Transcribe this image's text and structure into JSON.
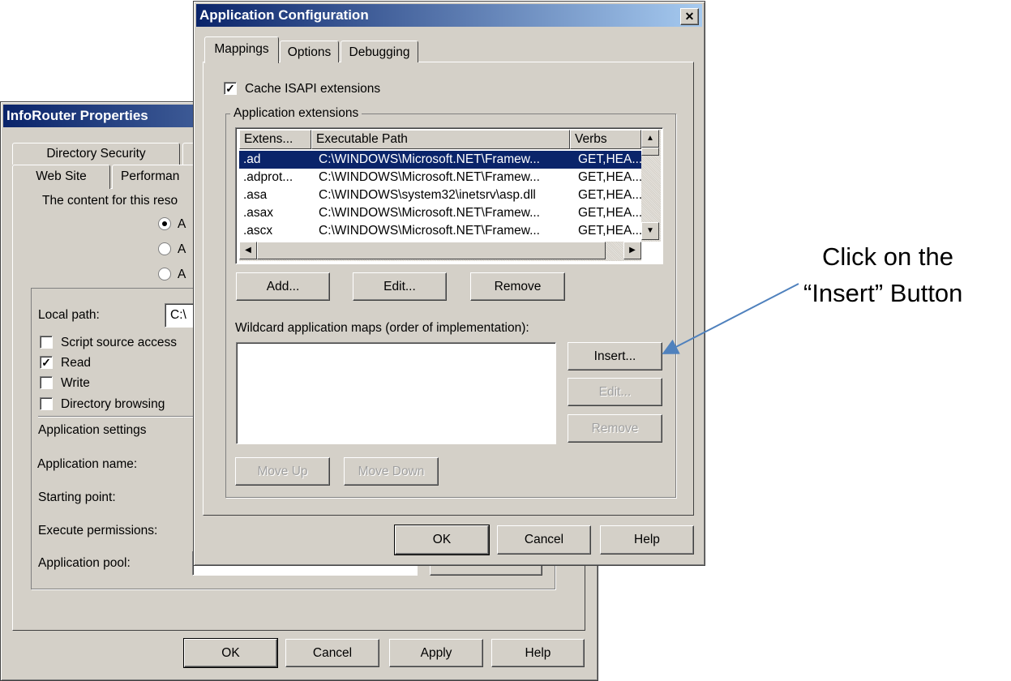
{
  "back_dialog": {
    "title": "InfoRouter Properties",
    "tabs": [
      "Directory Security",
      "Web Site",
      "Performan"
    ],
    "content_label": "The content for this reso",
    "radios": [
      {
        "label": "A",
        "checked": true
      },
      {
        "label": "A",
        "checked": false
      },
      {
        "label": "A",
        "checked": false
      }
    ],
    "local_path_label": "Local path:",
    "local_path_value": "C:\\",
    "checkboxes": [
      {
        "label": "Script source access",
        "checked": false
      },
      {
        "label": "Read",
        "checked": true
      },
      {
        "label": "Write",
        "checked": false
      },
      {
        "label": "Directory browsing",
        "checked": false
      }
    ],
    "app_settings_label": "Application settings",
    "app_name_label": "Application name:",
    "starting_point_label": "Starting point:",
    "exec_perm_label": "Execute permissions:",
    "app_pool_label": "Application pool:",
    "buttons": {
      "ok": "OK",
      "cancel": "Cancel",
      "apply": "Apply",
      "help": "Help"
    }
  },
  "front_dialog": {
    "title": "Application Configuration",
    "close": "✕",
    "tabs": [
      {
        "label": "Mappings",
        "active": true
      },
      {
        "label": "Options",
        "active": false
      },
      {
        "label": "Debugging",
        "active": false
      }
    ],
    "cache_isapi": {
      "label": "Cache ISAPI extensions",
      "checked": true
    },
    "extensions_group": "Application extensions",
    "columns": [
      "Extens...",
      "Executable Path",
      "Verbs"
    ],
    "rows": [
      {
        "ext": ".ad",
        "path": "C:\\WINDOWS\\Microsoft.NET\\Framew...",
        "verbs": "GET,HEA...",
        "selected": true
      },
      {
        "ext": ".adprot...",
        "path": "C:\\WINDOWS\\Microsoft.NET\\Framew...",
        "verbs": "GET,HEA...",
        "selected": false
      },
      {
        "ext": ".asa",
        "path": "C:\\WINDOWS\\system32\\inetsrv\\asp.dll",
        "verbs": "GET,HEA...",
        "selected": false
      },
      {
        "ext": ".asax",
        "path": "C:\\WINDOWS\\Microsoft.NET\\Framew...",
        "verbs": "GET,HEA...",
        "selected": false
      },
      {
        "ext": ".ascx",
        "path": "C:\\WINDOWS\\Microsoft.NET\\Framew...",
        "verbs": "GET,HEA...",
        "selected": false
      }
    ],
    "ext_buttons": {
      "add": "Add...",
      "edit": "Edit...",
      "remove": "Remove"
    },
    "wildcard_label": "Wildcard application maps (order of implementation):",
    "wildcard_buttons": {
      "insert": "Insert...",
      "edit": "Edit...",
      "remove": "Remove",
      "move_up": "Move Up",
      "move_down": "Move Down"
    },
    "buttons": {
      "ok": "OK",
      "cancel": "Cancel",
      "help": "Help"
    }
  },
  "annotation": {
    "line1": "Click on the",
    "line2": "“Insert” Button",
    "color": "#4f81bd"
  }
}
